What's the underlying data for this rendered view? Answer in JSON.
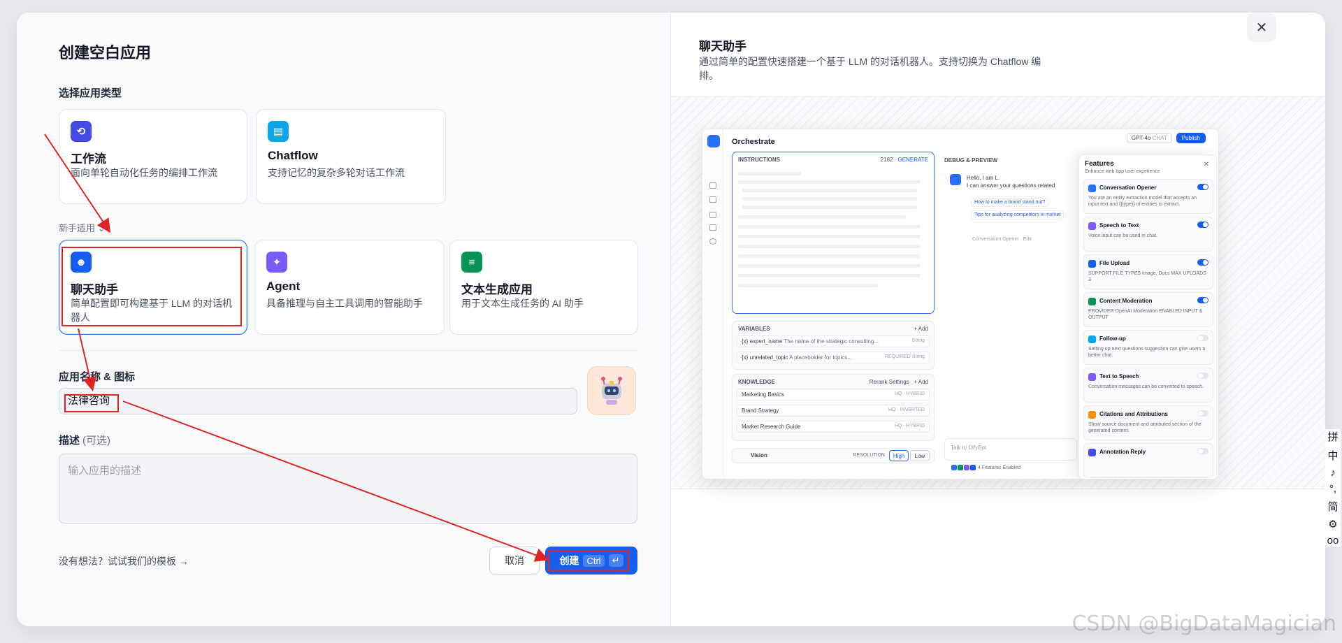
{
  "modal": {
    "title": "创建空白应用",
    "select_type_label": "选择应用类型",
    "beginner_label": "新手适用",
    "app_types": [
      {
        "title": "工作流",
        "desc": "面向单轮自动化任务的编排工作流",
        "icon": "workflow-icon",
        "color": "#444ce7"
      },
      {
        "title": "Chatflow",
        "desc": "支持记忆的复杂多轮对话工作流",
        "icon": "chatflow-icon",
        "color": "#0ba5ec"
      },
      {
        "title": "聊天助手",
        "desc": "简单配置即可构建基于 LLM 的对话机器人",
        "icon": "chatbot-icon",
        "color": "#155eef",
        "selected": true
      },
      {
        "title": "Agent",
        "desc": "具备推理与自主工具调用的智能助手",
        "icon": "agent-icon",
        "color": "#7a5af8"
      },
      {
        "title": "文本生成应用",
        "desc": "用于文本生成任务的 AI 助手",
        "icon": "text-generation-icon",
        "color": "#079455"
      }
    ],
    "name_label": "应用名称 & 图标",
    "name_value": "法律咨询",
    "desc_label": "描述",
    "desc_optional": "(可选)",
    "desc_placeholder": "输入应用的描述",
    "template_link": "没有想法？试试我们的模板 →",
    "cancel_label": "取消",
    "create_label": "创建",
    "create_kbd": "Ctrl",
    "create_kbd2": "↵"
  },
  "preview": {
    "title": "聊天助手",
    "desc": "通过简单的配置快速搭建一个基于 LLM 的对话机器人。支持切换为 Chatflow 编排。",
    "screenshot": {
      "heading": "Orchestrate",
      "model": "GPT-4o",
      "model_tag": "CHAT",
      "publish": "Publish",
      "instructions_label": "INSTRUCTIONS",
      "instructions_count": "2182",
      "generate": "GENERATE",
      "variables_label": "VARIABLES",
      "add_label": "+ Add",
      "variables": [
        {
          "name": "{x} expert_name",
          "desc": "The name of the strategic consulting...",
          "type": "String"
        },
        {
          "name": "{x} unrelated_topic",
          "desc": "A placeholder for topics...",
          "type": "REQUIRED  String"
        }
      ],
      "knowledge_label": "KNOWLEDGE",
      "rerank_label": "Rerank Settings",
      "knowledge": [
        {
          "name": "Marketing Basics",
          "tag": "HQ · HYBRID"
        },
        {
          "name": "Brand Strategy",
          "tag": "HQ · INVERTED"
        },
        {
          "name": "Market Research Guide",
          "tag": "HQ · HYBRID"
        }
      ],
      "vision_label": "Vision",
      "resolution_label": "RESOLUTION",
      "high": "High",
      "low": "Low",
      "debug_label": "DEBUG & PREVIEW",
      "chat_greeting": "Hello, I am L.",
      "chat_line": "I can answer your questions related",
      "chip1": "How to make a brand stand out?",
      "chip2": "Tips for analyzing competitors in market",
      "conv_opener": "Conversation Opener · Edit",
      "talk_placeholder": "Talk to DifyBot",
      "features_enabled": "4 Features Enabled",
      "features_title": "Features",
      "features_subtitle": "Enhance web app user experience",
      "features": [
        {
          "name": "Conversation Opener",
          "desc": "You are an entity extraction model that accepts an input text and {{type}} of entities to extract.",
          "on": true,
          "color": "#2970ff"
        },
        {
          "name": "Speech to Text",
          "desc": "Voice input can be used in chat.",
          "on": true,
          "color": "#7a5af8"
        },
        {
          "name": "File Upload",
          "desc": "SUPPORT FILE TYPES  Image, Docs   MAX UPLOADS 3",
          "on": true,
          "color": "#155eef"
        },
        {
          "name": "Content Moderation",
          "desc": "PROVIDER OpenAI Moderation  ENABLED INPUT & OUTPUT",
          "on": true,
          "color": "#079455"
        },
        {
          "name": "Follow-up",
          "desc": "Setting up next questions suggestion can give users a better chat.",
          "on": false,
          "color": "#0ba5ec"
        },
        {
          "name": "Text to Speech",
          "desc": "Conversation messages can be converted to speech.",
          "on": false,
          "color": "#7a5af8"
        },
        {
          "name": "Citations and Attributions",
          "desc": "Show source document and attributed section of the generated content.",
          "on": false,
          "color": "#f79009"
        },
        {
          "name": "Annotation Reply",
          "desc": "",
          "on": false,
          "color": "#444ce7"
        }
      ]
    }
  },
  "close_icon": "close-icon",
  "watermark": "CSDN @BigDataMagician",
  "ime_toolbar": [
    "拼",
    "中",
    "♪",
    "°,",
    "简",
    "⚙",
    "oo"
  ]
}
